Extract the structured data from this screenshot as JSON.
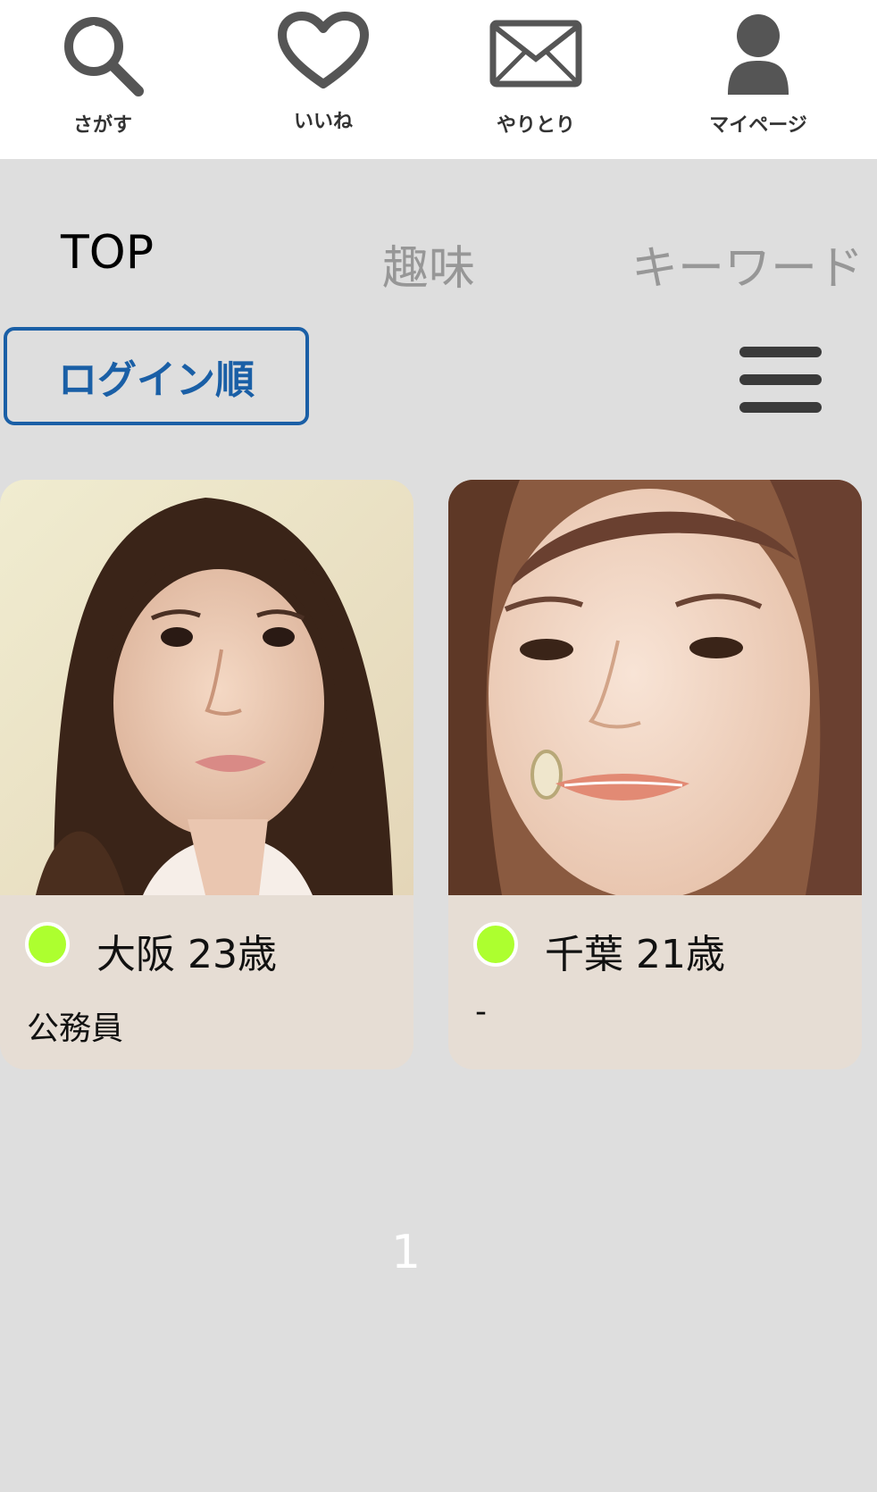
{
  "nav": {
    "search_label": "さがす",
    "like_label": "いいね",
    "messages_label": "やりとり",
    "mypage_label": "マイページ",
    "icons": [
      "search-icon",
      "heart-icon",
      "envelope-icon",
      "user-icon"
    ]
  },
  "tabs": [
    {
      "label": "TOP",
      "active": true
    },
    {
      "label": "趣味",
      "active": false
    },
    {
      "label": "キーワード",
      "active": false
    }
  ],
  "sort": {
    "label": "ログイン順"
  },
  "menu_icon": "hamburger-icon",
  "cards": [
    {
      "title": "大阪 23歳",
      "job": "公務員",
      "online": true
    },
    {
      "title": "千葉 21歳",
      "job": "-",
      "online": true
    }
  ],
  "pagination": {
    "current": "1"
  },
  "colors": {
    "accent": "#1a5fa6",
    "online": "#adff2f",
    "background": "#dedede",
    "card": "#e6ddd4",
    "tab_inactive": "#979797"
  }
}
